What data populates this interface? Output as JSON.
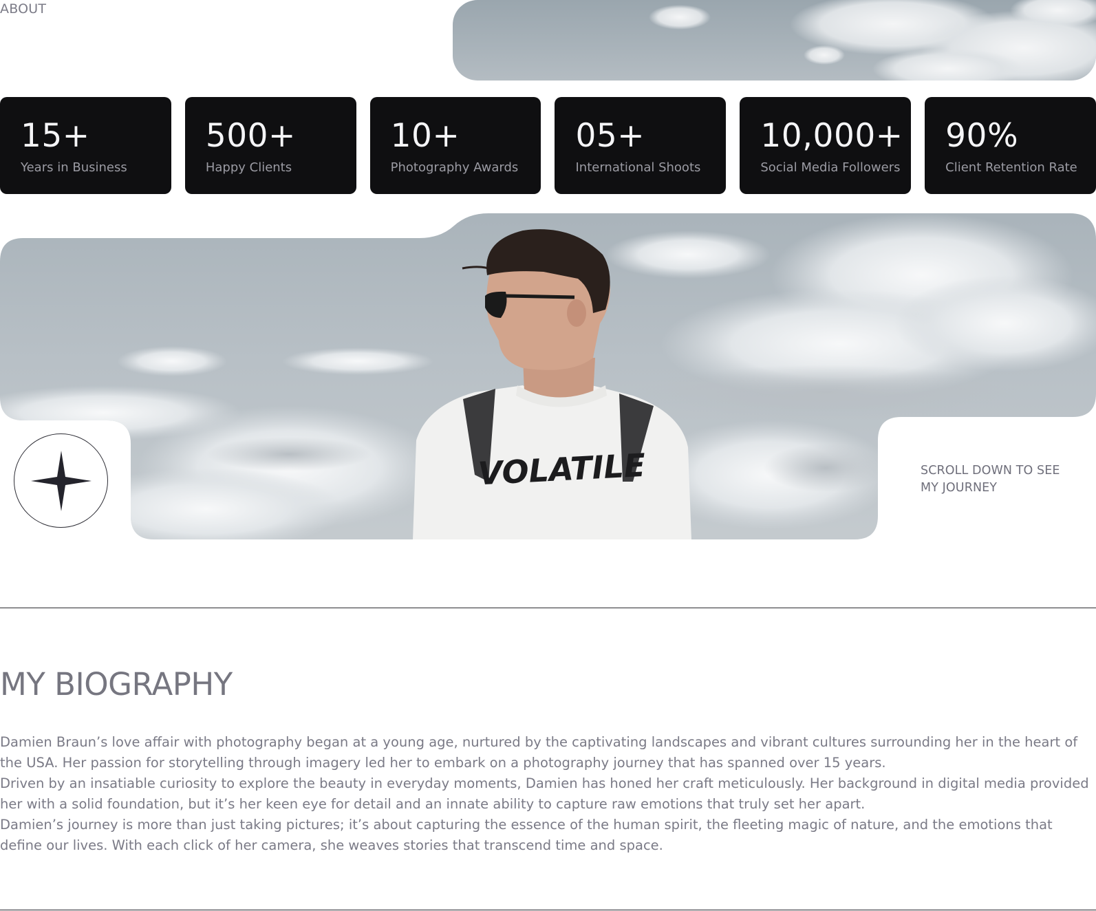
{
  "header": {
    "section_label": "ABOUT"
  },
  "stats": [
    {
      "value": "15+",
      "label": "Years in Business"
    },
    {
      "value": "500+",
      "label": "Happy Clients"
    },
    {
      "value": "10+",
      "label": "Photography Awards"
    },
    {
      "value": "05+",
      "label": "International Shoots"
    },
    {
      "value": "10,000+",
      "label": "Social Media Followers"
    },
    {
      "value": "90%",
      "label": "Client Retention Rate"
    }
  ],
  "hero": {
    "scroll_hint_line1": "SCROLL DOWN TO SEE",
    "scroll_hint_line2": "MY JOURNEY",
    "shirt_text": "VOLATILE"
  },
  "biography": {
    "title": "MY BIOGRAPHY",
    "paragraphs": [
      "Damien Braun’s love affair with photography began at a young age, nurtured by the captivating landscapes and vibrant cultures surrounding her in the heart of the USA. Her passion for storytelling through imagery led her to embark on a photography journey that has spanned over 15 years.",
      "Driven by an insatiable curiosity to explore the beauty in everyday moments, Damien has honed her craft meticulously. Her background in digital media provided her with a solid foundation, but it’s her keen eye for detail and an innate ability to capture raw emotions that truly set her apart.",
      "Damien’s journey is more than just taking pictures; it’s about capturing the essence of the human spirit, the fleeting magic of nature, and the emotions that define our lives. With each click of her camera, she weaves stories that transcend time and space."
    ]
  },
  "colors": {
    "card_bg": "#0f0f11",
    "text_muted": "#7a7a86",
    "sky": "#aab4bb"
  }
}
